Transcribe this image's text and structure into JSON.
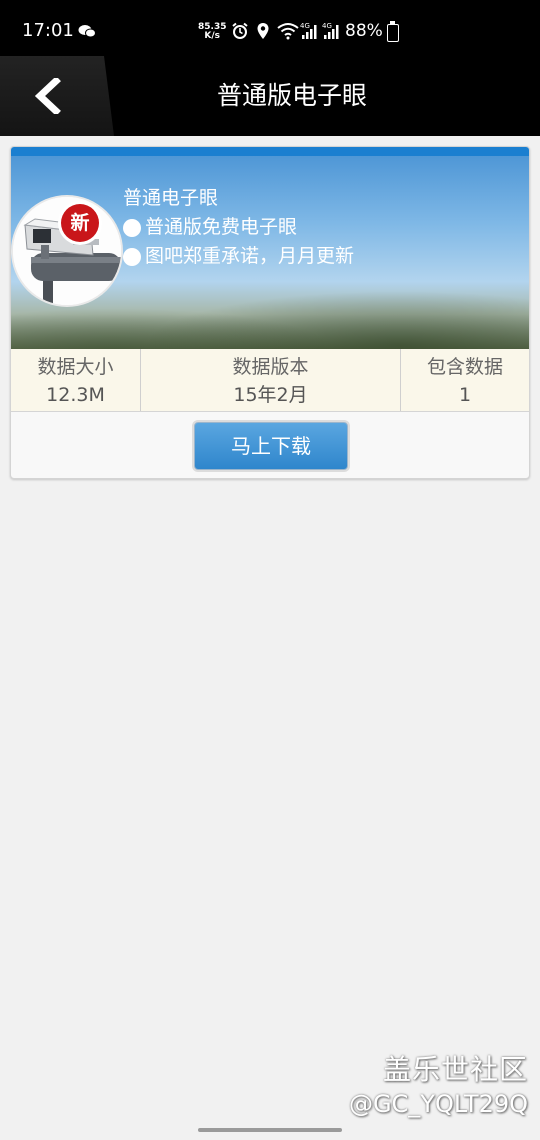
{
  "status_bar": {
    "time": "17:01",
    "net_speed_top": "85.35",
    "net_speed_bottom": "K/s",
    "battery": "88%",
    "icons": [
      "wechat-icon",
      "alarm-icon",
      "location-icon",
      "wifi-icon",
      "signal-icon",
      "signal-icon",
      "battery-icon"
    ]
  },
  "header": {
    "title": "普通版电子眼",
    "back_icon": "chevron-left-icon"
  },
  "card": {
    "accent": "#1b7fd0",
    "banner": {
      "badge": "新",
      "name": "普通电子眼",
      "lines": [
        "普通版免费电子眼",
        "图吧郑重承诺，月月更新"
      ]
    },
    "stats": [
      {
        "label": "数据大小",
        "value": "12.3M"
      },
      {
        "label": "数据版本",
        "value": "15年2月"
      },
      {
        "label": "包含数据",
        "value": "1"
      }
    ],
    "download_label": "马上下载"
  },
  "watermark": {
    "line1": "盖乐世社区",
    "line2": "@GC_YQLT29Q"
  }
}
